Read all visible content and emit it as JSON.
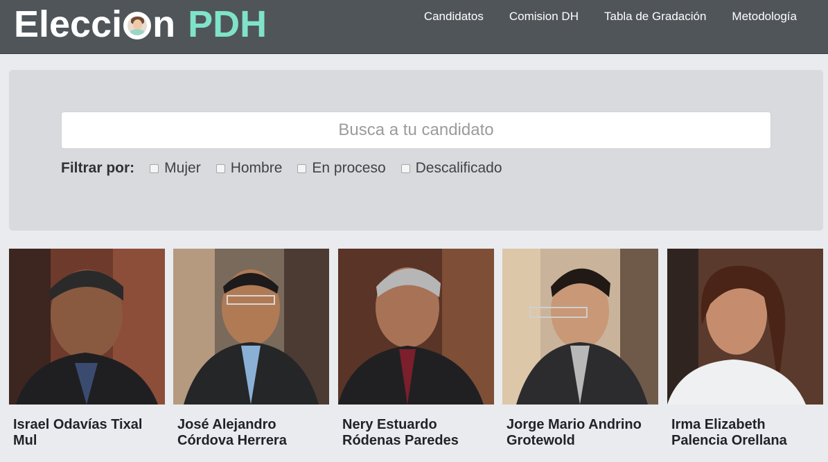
{
  "header": {
    "brand_word1_pre": "Elecci",
    "brand_word1_post": "n",
    "brand_word2": "PDH",
    "brand_color": "#7fe3c9",
    "nav": [
      {
        "label": "Candidatos"
      },
      {
        "label": "Comision DH"
      },
      {
        "label": "Tabla de Gradación"
      },
      {
        "label": "Metodología"
      }
    ]
  },
  "search": {
    "placeholder": "Busca a tu candidato",
    "value": ""
  },
  "filters": {
    "label": "Filtrar por:",
    "options": [
      {
        "label": "Mujer",
        "checked": false
      },
      {
        "label": "Hombre",
        "checked": false
      },
      {
        "label": "En proceso",
        "checked": false
      },
      {
        "label": "Descalificado",
        "checked": false
      }
    ]
  },
  "candidates": [
    {
      "name": "Israel Odavías Tixal Mul",
      "photo": "portrait-man-speaking"
    },
    {
      "name": "José Alejandro Córdova Herrera",
      "photo": "portrait-man-glasses"
    },
    {
      "name": "Nery Estuardo Ródenas Paredes",
      "photo": "portrait-man-gray-hair"
    },
    {
      "name": "Jorge Mario Andrino Grotewold",
      "photo": "portrait-man-glasses-young"
    },
    {
      "name": "Irma Elizabeth Palencia Orellana",
      "photo": "portrait-woman"
    }
  ]
}
